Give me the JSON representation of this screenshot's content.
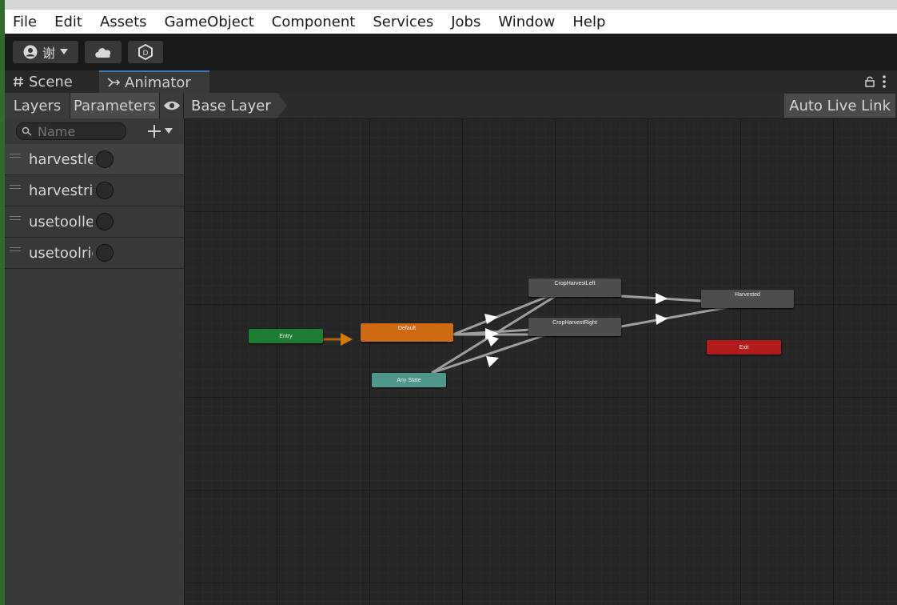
{
  "menu": [
    "File",
    "Edit",
    "Assets",
    "GameObject",
    "Component",
    "Services",
    "Jobs",
    "Window",
    "Help"
  ],
  "toolbar": {
    "account_initial": "谢",
    "icons": [
      "account-icon",
      "cloud-icon",
      "collab-icon"
    ]
  },
  "tabs": {
    "scene": "Scene",
    "animator": "Animator"
  },
  "left_panel": {
    "tabs": {
      "layers": "Layers",
      "parameters": "Parameters"
    },
    "search_placeholder": "Name",
    "parameters": [
      {
        "name": "harvestleft",
        "type": "trigger"
      },
      {
        "name": "harvestright",
        "type": "trigger"
      },
      {
        "name": "usetoolleft",
        "type": "trigger"
      },
      {
        "name": "usetoolright",
        "type": "trigger"
      }
    ]
  },
  "graph": {
    "breadcrumb": "Base Layer",
    "auto_live_link": "Auto Live Link",
    "states": {
      "entry": "Entry",
      "default": "Default",
      "any_state": "Any State",
      "crop_harvest_left": "CropHarvestLeft",
      "crop_harvest_right": "CropHarvestRight",
      "harvested": "Harvested",
      "exit": "Exit"
    },
    "colors": {
      "entry": "#1d7d33",
      "default": "#cf6a14",
      "any_state": "#4f968b",
      "state": "#4d4d4d",
      "exit": "#b31c1c"
    }
  }
}
